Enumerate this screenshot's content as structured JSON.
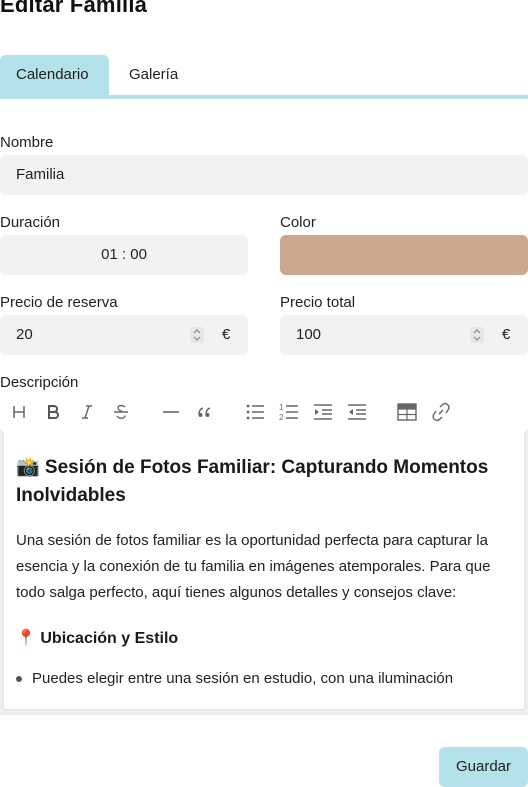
{
  "page": {
    "title": "Editar Familia"
  },
  "tabs": [
    {
      "label": "Calendario",
      "active": true
    },
    {
      "label": "Galería",
      "active": false
    }
  ],
  "form": {
    "name": {
      "label": "Nombre",
      "value": "Familia"
    },
    "duration": {
      "label": "Duración",
      "value": "01 : 00"
    },
    "color": {
      "label": "Color",
      "value": "#caa88d"
    },
    "booking_price": {
      "label": "Precio de reserva",
      "value": "20",
      "currency": "€"
    },
    "total_price": {
      "label": "Precio total",
      "value": "100",
      "currency": "€"
    },
    "description": {
      "label": "Descripción"
    }
  },
  "toolbar": {
    "items": [
      "heading-icon",
      "bold-icon",
      "italic-icon",
      "strikethrough-icon",
      "horizontal-rule-icon",
      "quote-icon",
      "bullet-list-icon",
      "ordered-list-icon",
      "indent-icon",
      "outdent-icon",
      "table-icon",
      "link-icon"
    ]
  },
  "editor": {
    "heading": "📸 Sesión de Fotos Familiar: Capturando Momentos Inolvidables",
    "intro": "Una sesión de fotos familiar es la oportunidad perfecta para capturar la esencia y la conexión de tu familia en imágenes atemporales. Para que todo salga perfecto, aquí tienes algunos detalles y consejos clave:",
    "section_title": "📍 Ubicación y Estilo",
    "bullets": [
      "Puedes elegir entre una sesión en estudio, con una iluminación"
    ]
  },
  "actions": {
    "save_label": "Guardar"
  },
  "colors": {
    "accent": "#b3e2ea",
    "field_bg": "#f2f2f2"
  }
}
